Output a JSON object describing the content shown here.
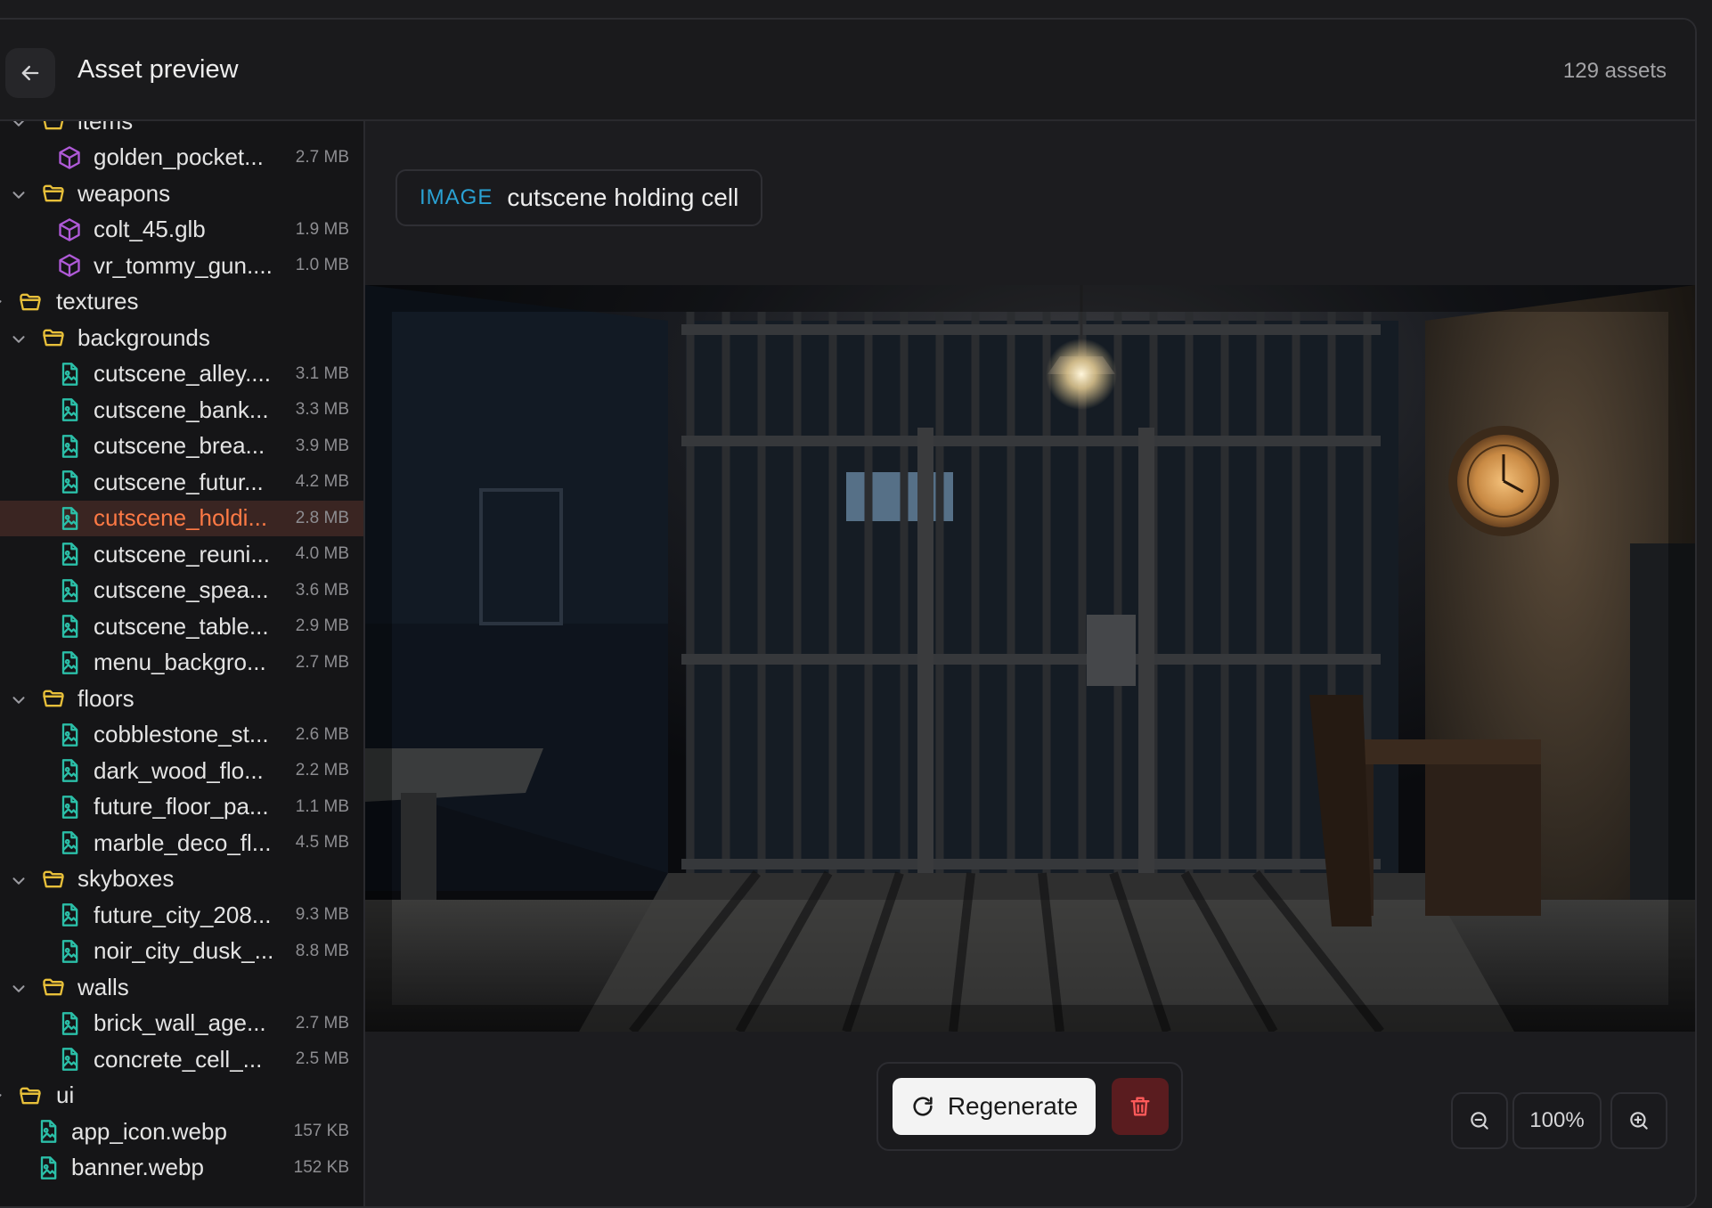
{
  "header": {
    "title": "Asset preview",
    "count": "129 assets"
  },
  "tree": [
    {
      "type": "folder",
      "depth": 1,
      "name": "items",
      "expanded": true
    },
    {
      "type": "model",
      "depth": 2,
      "name": "golden_pocket...",
      "size": "2.7 MB"
    },
    {
      "type": "folder",
      "depth": 1,
      "name": "weapons",
      "expanded": true
    },
    {
      "type": "model",
      "depth": 2,
      "name": "colt_45.glb",
      "size": "1.9 MB"
    },
    {
      "type": "model",
      "depth": 2,
      "name": "vr_tommy_gun....",
      "size": "1.0 MB"
    },
    {
      "type": "folder",
      "depth": 0,
      "name": "textures",
      "expanded": true
    },
    {
      "type": "folder",
      "depth": 1,
      "name": "backgrounds",
      "expanded": true
    },
    {
      "type": "image",
      "depth": 2,
      "name": "cutscene_alley....",
      "size": "3.1 MB"
    },
    {
      "type": "image",
      "depth": 2,
      "name": "cutscene_bank...",
      "size": "3.3 MB"
    },
    {
      "type": "image",
      "depth": 2,
      "name": "cutscene_brea...",
      "size": "3.9 MB"
    },
    {
      "type": "image",
      "depth": 2,
      "name": "cutscene_futur...",
      "size": "4.2 MB"
    },
    {
      "type": "image",
      "depth": 2,
      "name": "cutscene_holdi...",
      "size": "2.8 MB",
      "selected": true
    },
    {
      "type": "image",
      "depth": 2,
      "name": "cutscene_reuni...",
      "size": "4.0 MB"
    },
    {
      "type": "image",
      "depth": 2,
      "name": "cutscene_spea...",
      "size": "3.6 MB"
    },
    {
      "type": "image",
      "depth": 2,
      "name": "cutscene_table...",
      "size": "2.9 MB"
    },
    {
      "type": "image",
      "depth": 2,
      "name": "menu_backgro...",
      "size": "2.7 MB"
    },
    {
      "type": "folder",
      "depth": 1,
      "name": "floors",
      "expanded": true
    },
    {
      "type": "image",
      "depth": 2,
      "name": "cobblestone_st...",
      "size": "2.6 MB"
    },
    {
      "type": "image",
      "depth": 2,
      "name": "dark_wood_flo...",
      "size": "2.2 MB"
    },
    {
      "type": "image",
      "depth": 2,
      "name": "future_floor_pa...",
      "size": "1.1 MB"
    },
    {
      "type": "image",
      "depth": 2,
      "name": "marble_deco_fl...",
      "size": "4.5 MB"
    },
    {
      "type": "folder",
      "depth": 1,
      "name": "skyboxes",
      "expanded": true
    },
    {
      "type": "image",
      "depth": 2,
      "name": "future_city_208...",
      "size": "9.3 MB"
    },
    {
      "type": "image",
      "depth": 2,
      "name": "noir_city_dusk_...",
      "size": "8.8 MB"
    },
    {
      "type": "folder",
      "depth": 1,
      "name": "walls",
      "expanded": true
    },
    {
      "type": "image",
      "depth": 2,
      "name": "brick_wall_age...",
      "size": "2.7 MB"
    },
    {
      "type": "image",
      "depth": 2,
      "name": "concrete_cell_...",
      "size": "2.5 MB"
    },
    {
      "type": "folder",
      "depth": 0,
      "name": "ui",
      "expanded": true
    },
    {
      "type": "image",
      "depth": 1,
      "name": "app_icon.webp",
      "size": "157 KB"
    },
    {
      "type": "image",
      "depth": 1,
      "name": "banner.webp",
      "size": "152 KB"
    }
  ],
  "preview": {
    "type_label": "IMAGE",
    "name": "cutscene holding cell"
  },
  "actions": {
    "regenerate_label": "Regenerate"
  },
  "zoom": {
    "level": "100%"
  },
  "colors": {
    "accent_selected": "#ff7a45",
    "tag_type": "#2aa2d4",
    "folder_icon": "#e8c03a",
    "model_icon": "#b05ad8",
    "image_icon": "#2bbfa8",
    "delete_bg": "#5a1c1f"
  }
}
